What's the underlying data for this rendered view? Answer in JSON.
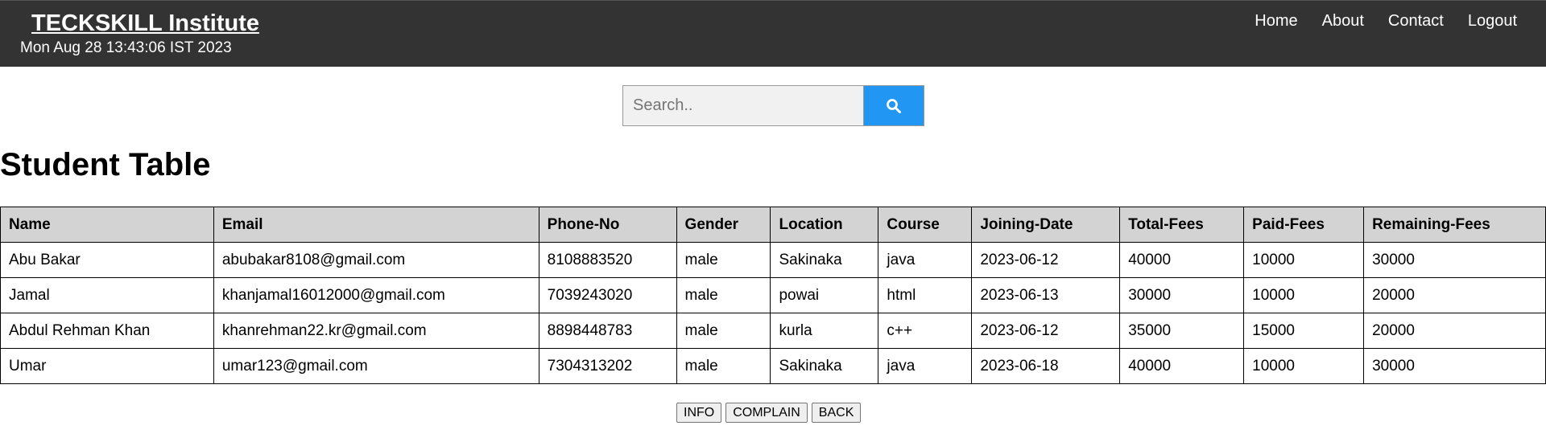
{
  "header": {
    "brand": "TECKSKILL Institute",
    "datetime": "Mon Aug 28 13:43:06 IST 2023",
    "nav": [
      "Home",
      "About",
      "Contact",
      "Logout"
    ],
    "bg_color": "#333333"
  },
  "search": {
    "placeholder": "Search..",
    "value": "",
    "button_icon": "search-icon",
    "button_color": "#2196F3"
  },
  "page_title": "Student Table",
  "table": {
    "columns": [
      "Name",
      "Email",
      "Phone-No",
      "Gender",
      "Location",
      "Course",
      "Joining-Date",
      "Total-Fees",
      "Paid-Fees",
      "Remaining-Fees"
    ],
    "rows": [
      [
        "Abu Bakar",
        "abubakar8108@gmail.com",
        "8108883520",
        "male",
        "Sakinaka",
        "java",
        "2023-06-12",
        "40000",
        "10000",
        "30000"
      ],
      [
        "Jamal",
        "khanjamal16012000@gmail.com",
        "7039243020",
        "male",
        "powai",
        "html",
        "2023-06-13",
        "30000",
        "10000",
        "20000"
      ],
      [
        "Abdul Rehman Khan",
        "khanrehman22.kr@gmail.com",
        "8898448783",
        "male",
        "kurla",
        "c++",
        "2023-06-12",
        "35000",
        "15000",
        "20000"
      ],
      [
        "Umar",
        "umar123@gmail.com",
        "7304313202",
        "male",
        "Sakinaka",
        "java",
        "2023-06-18",
        "40000",
        "10000",
        "30000"
      ]
    ]
  },
  "actions": {
    "info": "INFO",
    "complain": "COMPLAIN",
    "back": "BACK"
  }
}
